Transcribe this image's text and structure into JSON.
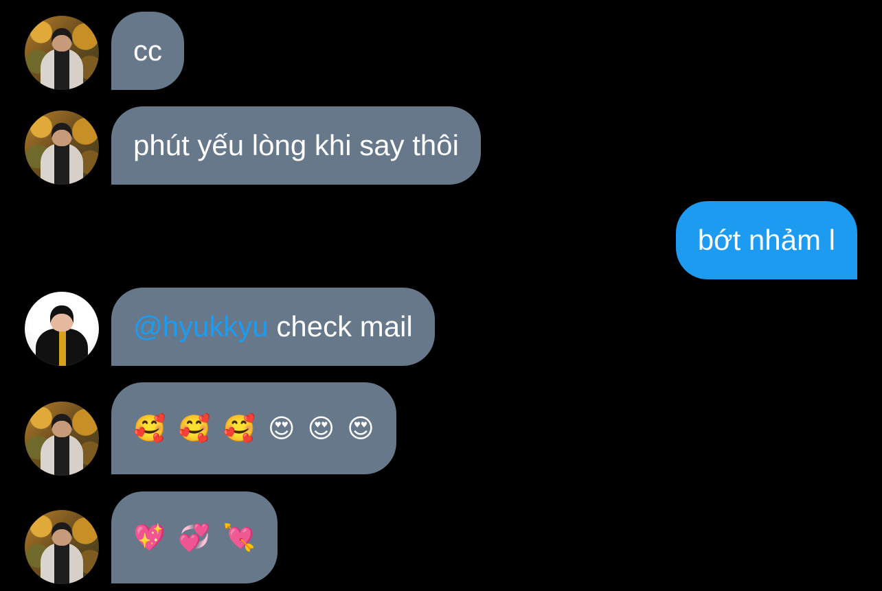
{
  "messages": [
    {
      "sender": "other",
      "avatar": "profile-photo",
      "text": "cc"
    },
    {
      "sender": "other",
      "avatar": "profile-photo",
      "text": "phút yếu lòng khi say thôi"
    },
    {
      "sender": "me",
      "text": "bớt nhảm l"
    },
    {
      "sender": "other",
      "avatar": "profile-photo-glasses",
      "mention": "@hyukkyu",
      "text": "check mail"
    },
    {
      "sender": "other",
      "avatar": "profile-photo",
      "emojis": [
        "🥰",
        "🥰",
        "🥰",
        "😍",
        "😍",
        "😍"
      ]
    },
    {
      "sender": "other",
      "avatar": "profile-photo",
      "emojis": [
        "💖",
        "💞",
        "💘"
      ]
    }
  ],
  "colors": {
    "background": "#000000",
    "incoming_bubble": "#66788a",
    "outgoing_bubble": "#1d9bf0",
    "mention": "#1d9bf0",
    "text": "#ffffff"
  }
}
